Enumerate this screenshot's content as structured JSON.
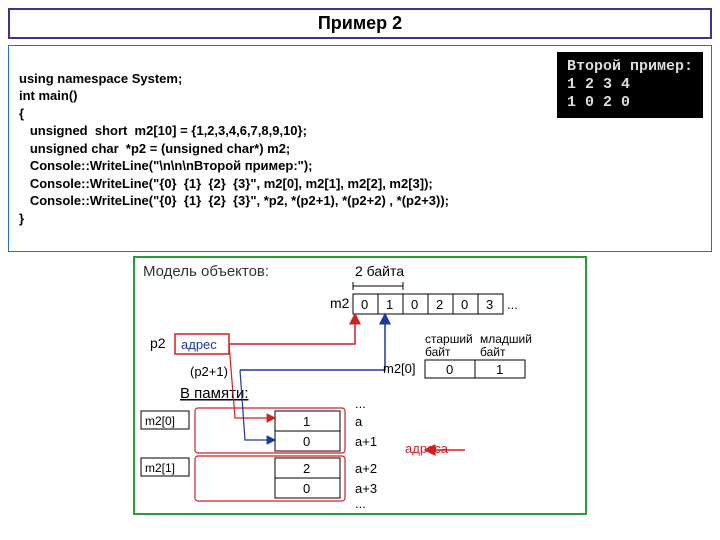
{
  "title": "Пример 2",
  "code": {
    "l1": "using namespace System;",
    "l2": "int main()",
    "l3": "{",
    "l4": "   unsigned  short  m2[10] = {1,2,3,4,6,7,8,9,10};",
    "l5": "   unsigned char  *p2 = (unsigned char*) m2;",
    "l6": "   Console::WriteLine(\"\\n\\n\\nВторой пример:\");",
    "l7": "   Console::WriteLine(\"{0}  {1}  {2}  {3}\", m2[0], m2[1], m2[2], m2[3]);",
    "l8": "   Console::WriteLine(\"{0}  {1}  {2}  {3}\", *p2, *(p2+1), *(p2+2) , *(p2+3));",
    "l9": "}"
  },
  "console": {
    "l1": "Второй пример:",
    "l2": "1 2 3 4",
    "l3": "1 0 2 0"
  },
  "diagram": {
    "model_label": "Модель объектов:",
    "two_bytes": "2 байта",
    "m2_label": "m2",
    "m2_cells": [
      "0",
      "1",
      "0",
      "2",
      "0",
      "3"
    ],
    "m2_dots": "...",
    "p2_label": "p2",
    "addr_label": "адрес",
    "p2plus1": "(p2+1)",
    "memory_label": "В памяти:",
    "m2_0_label": "m2[0]",
    "m2_1_label": "m2[1]",
    "mem_cells": [
      "1",
      "0",
      "2",
      "0"
    ],
    "addr_a": "a",
    "addr_a1": "a+1",
    "addr_a2": "a+2",
    "addr_a3": "a+3",
    "dots_top": "...",
    "dots_bot": "...",
    "older_byte": "старший\nбайт",
    "younger_byte": "младший\nбайт",
    "m2_0_row_label": "m2[0]",
    "row_older": "0",
    "row_younger": "1",
    "addresses_label": "адреса"
  }
}
